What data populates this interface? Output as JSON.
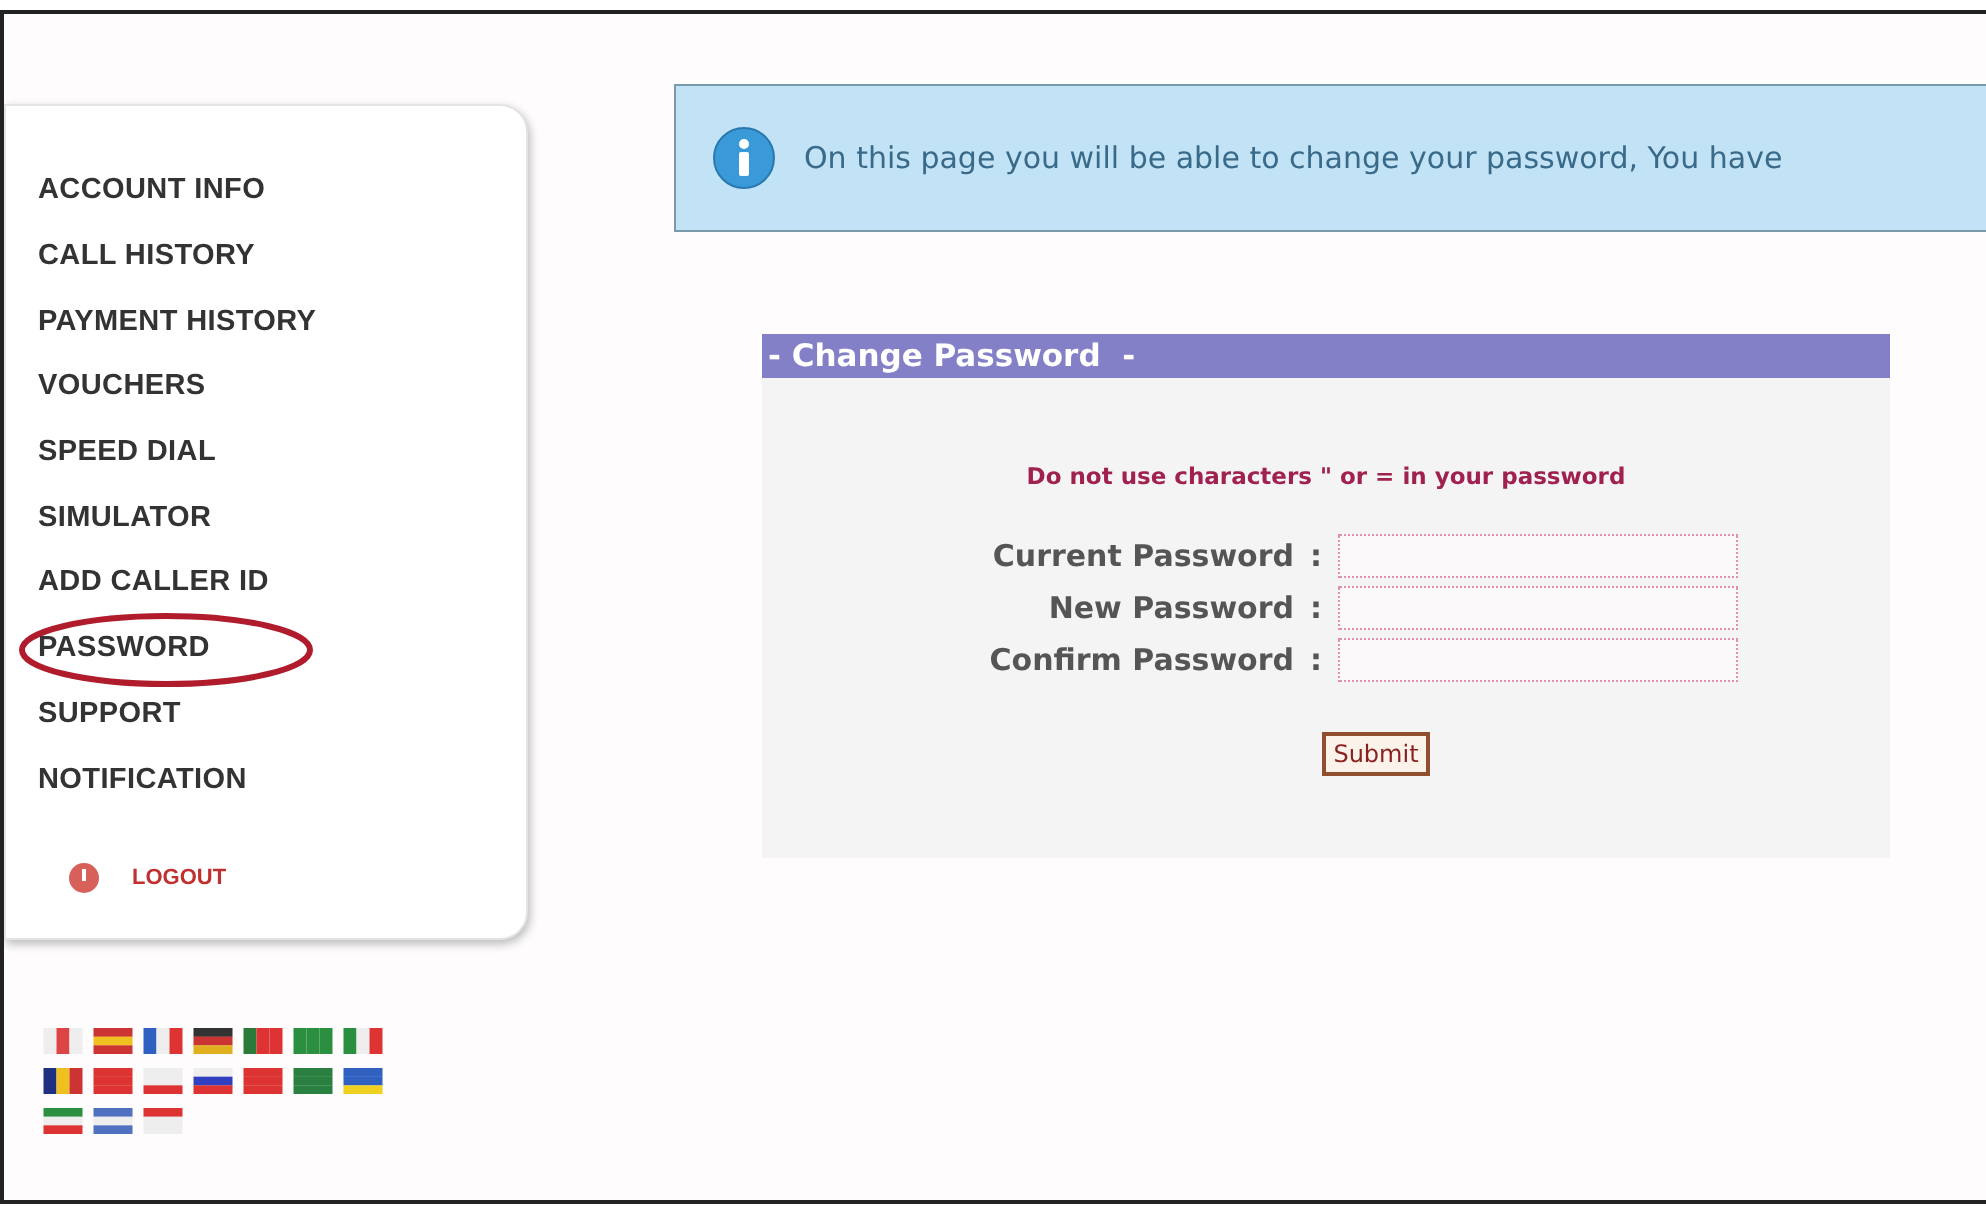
{
  "sidebar": {
    "items": [
      {
        "label": "ACCOUNT INFO",
        "circled": false
      },
      {
        "label": "CALL HISTORY",
        "circled": false
      },
      {
        "label": "PAYMENT HISTORY",
        "circled": false
      },
      {
        "label": "VOUCHERS",
        "circled": false
      },
      {
        "label": "SPEED DIAL",
        "circled": false
      },
      {
        "label": "SIMULATOR",
        "circled": false
      },
      {
        "label": "ADD CALLER ID",
        "circled": false
      },
      {
        "label": "PASSWORD",
        "circled": true
      },
      {
        "label": "SUPPORT",
        "circled": false
      },
      {
        "label": "NOTIFICATION",
        "circled": false
      }
    ],
    "logout": "LOGOUT"
  },
  "info_message": "On this page you will be able to change your password, You have",
  "form": {
    "title": "- Change Password  -",
    "warning": "Do not use characters \" or = in your password",
    "fields": [
      {
        "label": "Current Password",
        "separator": ":"
      },
      {
        "label": "New Password",
        "separator": ":"
      },
      {
        "label": "Confirm Password",
        "separator": ":"
      }
    ],
    "submit": "Submit"
  }
}
